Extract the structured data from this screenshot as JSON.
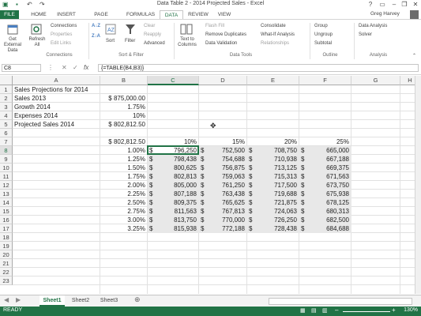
{
  "window": {
    "title": "Data Table 2 - 2014 Projected Sales - Excel",
    "user": "Greg Harvey"
  },
  "tabs": [
    "FILE",
    "HOME",
    "INSERT",
    "PAGE LAYOUT",
    "FORMULAS",
    "DATA",
    "REVIEW",
    "VIEW"
  ],
  "active_tab": "DATA",
  "ribbon": {
    "get_external": "Get External Data",
    "refresh": "Refresh All",
    "connections": "Connections",
    "properties": "Properties",
    "edit_links": "Edit Links",
    "connections_group": "Connections",
    "sort": "Sort",
    "filter": "Filter",
    "clear": "Clear",
    "reapply": "Reapply",
    "advanced": "Advanced",
    "sort_filter_group": "Sort & Filter",
    "text_to_columns": "Text to Columns",
    "flash_fill": "Flash Fill",
    "remove_duplicates": "Remove Duplicates",
    "data_validation": "Data Validation",
    "consolidate": "Consolidate",
    "what_if": "What-If Analysis",
    "relationships": "Relationships",
    "data_tools_group": "Data Tools",
    "group": "Group",
    "ungroup": "Ungroup",
    "subtotal": "Subtotal",
    "outline_group": "Outline",
    "data_analysis": "Data Analysis",
    "solver": "Solver",
    "analysis_group": "Analysis"
  },
  "formula_bar": {
    "name_box": "C8",
    "fx": "fx",
    "formula": "{=TABLE(B4,B3)}"
  },
  "columns": [
    "A",
    "B",
    "C",
    "D",
    "E",
    "F",
    "G",
    "H"
  ],
  "selected_column": "C",
  "rows": [
    "1",
    "2",
    "3",
    "4",
    "5",
    "6",
    "7",
    "8",
    "9",
    "10",
    "11",
    "12",
    "13",
    "14",
    "15",
    "16",
    "17",
    "18",
    "19",
    "20",
    "21",
    "22",
    "23"
  ],
  "selected_row": "8",
  "cells": {
    "A1": "Sales Projections for 2014",
    "A2": "Sales 2013",
    "B2": "$ 875,000.00",
    "A3": "Growth 2014",
    "B3": "1.75%",
    "A4": "Expenses 2014",
    "B4": "10%",
    "A5": "Projected Sales 2014",
    "B5": "$ 802,812.50",
    "B7": "$ 802,812.50",
    "C7": "10%",
    "D7": "15%",
    "E7": "20%",
    "F7": "25%"
  },
  "table": {
    "growth": [
      "1.00%",
      "1.25%",
      "1.50%",
      "1.75%",
      "2.00%",
      "2.25%",
      "2.50%",
      "2.75%",
      "3.00%",
      "3.25%"
    ],
    "currency": "$",
    "c": [
      "796,250",
      "798,438",
      "800,625",
      "802,813",
      "805,000",
      "807,188",
      "809,375",
      "811,563",
      "813,750",
      "815,938"
    ],
    "d": [
      "752,500",
      "754,688",
      "756,875",
      "759,063",
      "761,250",
      "763,438",
      "765,625",
      "767,813",
      "770,000",
      "772,188"
    ],
    "e": [
      "708,750",
      "710,938",
      "713,125",
      "715,313",
      "717,500",
      "719,688",
      "721,875",
      "724,063",
      "726,250",
      "728,438"
    ],
    "f": [
      "665,000",
      "667,188",
      "669,375",
      "671,563",
      "673,750",
      "675,938",
      "678,125",
      "680,313",
      "682,500",
      "684,688"
    ]
  },
  "sheets": [
    "Sheet1",
    "Sheet2",
    "Sheet3"
  ],
  "active_sheet": "Sheet1",
  "status": {
    "ready": "READY",
    "zoom": "130%"
  }
}
